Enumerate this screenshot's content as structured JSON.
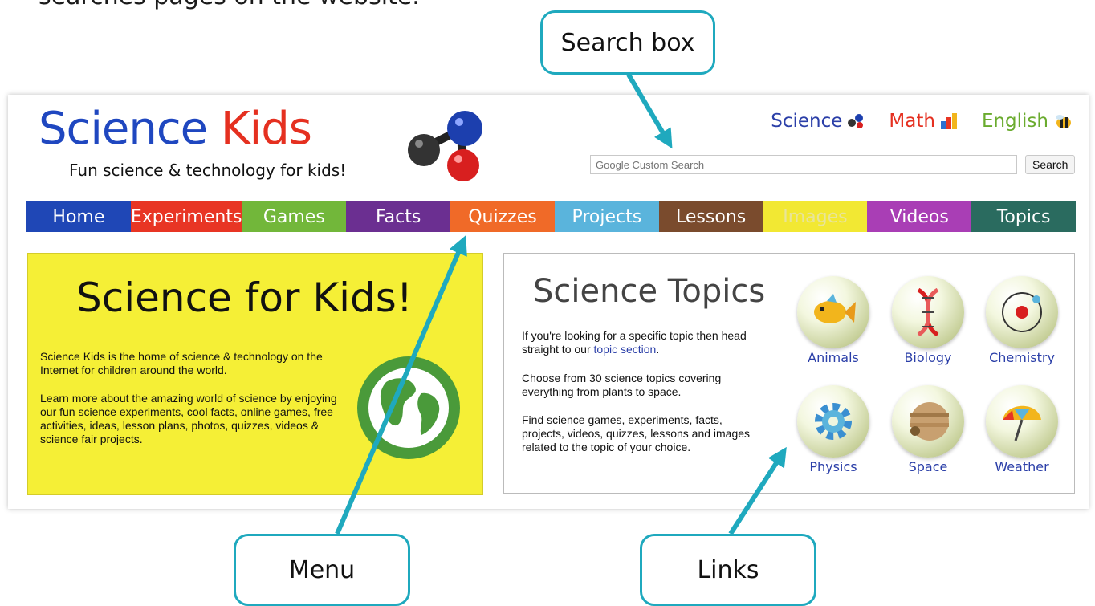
{
  "caption": "searches pages on the website.",
  "callouts": {
    "search": "Search box",
    "menu": "Menu",
    "links": "Links"
  },
  "header": {
    "logo_science": "Science",
    "logo_kids": "Kids",
    "tagline": "Fun science & technology for kids!",
    "subjects": [
      {
        "label": "Science",
        "color": "#2b3fa8"
      },
      {
        "label": "Math",
        "color": "#e53020"
      },
      {
        "label": "English",
        "color": "#6aab2e"
      }
    ],
    "search": {
      "placeholder": "Google Custom Search",
      "button": "Search"
    }
  },
  "nav": [
    {
      "label": "Home",
      "color": "#1f47b6"
    },
    {
      "label": "Experiments",
      "color": "#e83524"
    },
    {
      "label": "Games",
      "color": "#72b73a"
    },
    {
      "label": "Facts",
      "color": "#6b2f91"
    },
    {
      "label": "Quizzes",
      "color": "#f06a28"
    },
    {
      "label": "Projects",
      "color": "#5ab4dc"
    },
    {
      "label": "Lessons",
      "color": "#7a4b2d"
    },
    {
      "label": "Images",
      "color": "#f2e833"
    },
    {
      "label": "Videos",
      "color": "#a93eb5"
    },
    {
      "label": "Topics",
      "color": "#2a6b5f"
    }
  ],
  "intro": {
    "title": "Science for Kids!",
    "p1": "Science Kids is the home of science & technology on the Internet for children around the world.",
    "p2": "Learn more about the amazing world of science by enjoying our fun science experiments, cool facts, online games, free activities, ideas, lesson plans, photos, quizzes, videos & science fair projects."
  },
  "topics": {
    "title": "Science Topics",
    "p1_before": "If you're looking for a specific topic then head straight to our ",
    "p1_link": "topic section",
    "p1_after": ".",
    "p2": "Choose from 30 science topics covering everything from plants to space.",
    "p3": "Find science games, experiments, facts, projects, videos, quizzes, lessons and images related to the topic of your choice.",
    "items": [
      {
        "label": "Animals",
        "icon": "fish-icon"
      },
      {
        "label": "Biology",
        "icon": "dna-icon"
      },
      {
        "label": "Chemistry",
        "icon": "atom-icon"
      },
      {
        "label": "Physics",
        "icon": "gear-icon"
      },
      {
        "label": "Space",
        "icon": "planet-icon"
      },
      {
        "label": "Weather",
        "icon": "umbrella-icon"
      }
    ]
  },
  "colors": {
    "callout": "#1fa9be",
    "intro_bg": "#f5ef36",
    "link": "#2b3fa8"
  }
}
